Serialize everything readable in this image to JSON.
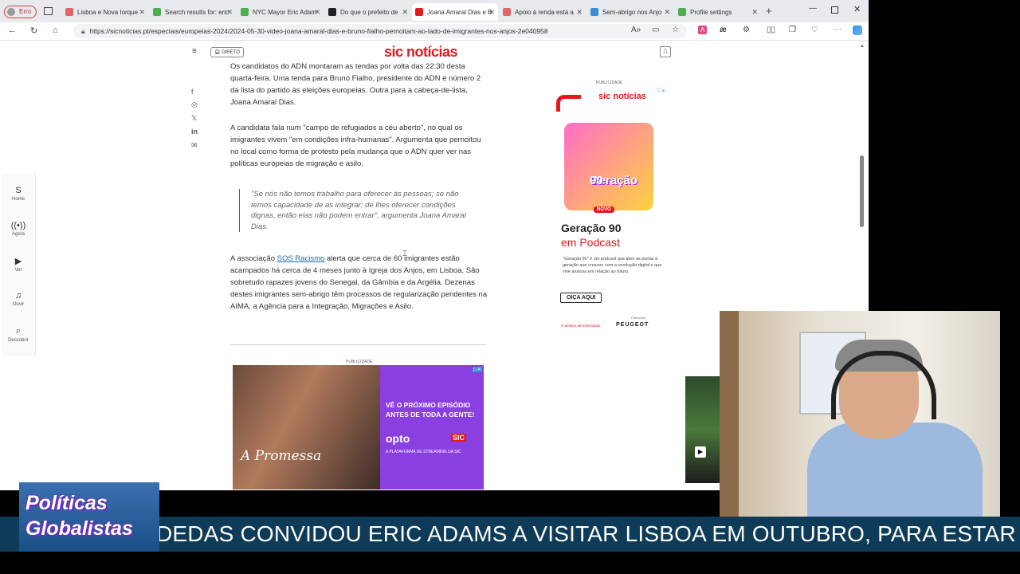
{
  "browser": {
    "profile_label": "Erro",
    "tabs": [
      {
        "label": "Lisboa e Nova Iorque",
        "color": "#e06666"
      },
      {
        "label": "Search results for: eric",
        "color": "#4caf50"
      },
      {
        "label": "NYC Mayor Eric Adam",
        "color": "#4caf50"
      },
      {
        "label": "Do que o prefeito de",
        "color": "#222222"
      },
      {
        "label": "Joana Amaral Dias e B",
        "color": "#e3191e"
      },
      {
        "label": "Apoio à renda está a",
        "color": "#e06666"
      },
      {
        "label": "Sem-abrigo nos Anjo",
        "color": "#3a8fd6"
      },
      {
        "label": "Profile settings",
        "color": "#4caf50"
      }
    ],
    "url": "https://sicnoticias.pt/especiais/europeias-2024/2024-05-30-video-joana-amaral-dias-e-bruno-fialho-pernoitam-ao-lado-de-imigrantes-nos-anjos-2e040958",
    "reader_icon_label": "A",
    "ae_label": "æ"
  },
  "site": {
    "brand": "sic notícias",
    "direto_label": "DIRETO"
  },
  "left_nav": [
    {
      "icon": "S",
      "label": "Home"
    },
    {
      "icon": "((•))",
      "label": "Agora"
    },
    {
      "icon": "▶",
      "label": "Ver"
    },
    {
      "icon": "♫",
      "label": "Ouvir"
    },
    {
      "icon": "⌕",
      "label": "Descobrir"
    }
  ],
  "article": {
    "p1": "Os candidatos do ADN montaram as tendas por volta das 22:30 desta quarta-feira. Uma tenda para Bruno Fialho, presidente do ADN e número 2 da lista do partido às eleições europeias. Outra para a cabeça-de-lista, Joana Amaral Dias.",
    "p2": "A candidata fala num \"campo de refugiados a céu aberto\", no qual os imigrantes vivem \"em condições infra-humanas\". Argumenta que pernoitou no local como forma de protesto pela mudança que o ADN quer ver nas políticas europeias de migração e asilo.",
    "quote": "\"Se nós não temos trabalho para oferecer às pessoas; se não temos capacidade de as integrar; de lhes oferecer condições dignas, então elas não podem entrar\", argumenta Joana Amaral Dias.",
    "p3_before": "A associação ",
    "p3_link": "SOS Racismo",
    "p3_after": " alerta que cerca de 60 imigrantes estão acampados há cerca de 4 meses junto à Igreja dos Anjos, em Lisboa. São sobretudo rapazes jovens do Senegal, da Gâmbia e da Argélia. Dezenas destes imigrantes sem-abrigo têm processos de regularização pendentes na AIMA, a Agência para a Integração, Migrações e Asilo."
  },
  "ad_bottom": {
    "label": "PUBLICIDADE",
    "title": "A Promessa",
    "cta": "VÊ O PRÓXIMO EPISÓDIO ANTES DE TODA A GENTE!",
    "logo": "opto",
    "sic": "SIC",
    "tagline": "A PLATAFORMA DE STREAMING DA SIC"
  },
  "ad_side": {
    "label": "PUBLICIDADE",
    "brand": "sic notícias",
    "cover_text_1": "Geração",
    "cover_text_2": "90",
    "novo": "NOVO",
    "heading1": "Geração 90",
    "heading2": "em Podcast",
    "desc": "\"Geração 90\" é um podcast que abre as portas à geração que cresceu com a revolução digital e que vive ansiosa em relação ao futuro.",
    "button": "OIÇA AQUI",
    "footer": "O destino da Informação.",
    "sponsor_label": "Patrocínio",
    "sponsor": "PEUGEOT"
  },
  "overlay": {
    "logo_line1": "Políticas",
    "logo_line2": "Globalistas",
    "ticker": "DEDAS CONVIDOU ERIC ADAMS A VISITAR LISBOA EM OUTUBRO, PARA ESTAR PR"
  }
}
